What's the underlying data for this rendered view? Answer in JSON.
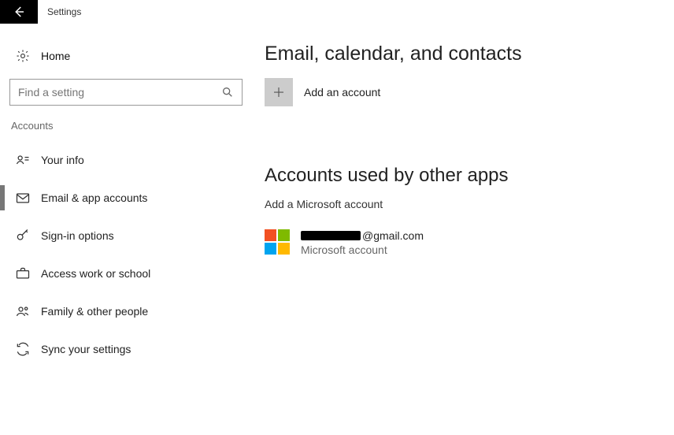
{
  "header": {
    "title": "Settings"
  },
  "sidebar": {
    "home_label": "Home",
    "search_placeholder": "Find a setting",
    "category_label": "Accounts",
    "items": [
      {
        "label": "Your info"
      },
      {
        "label": "Email & app accounts"
      },
      {
        "label": "Sign-in options"
      },
      {
        "label": "Access work or school"
      },
      {
        "label": "Family & other people"
      },
      {
        "label": "Sync your settings"
      }
    ]
  },
  "main": {
    "section1_title": "Email, calendar, and contacts",
    "add_account_label": "Add an account",
    "section2_title": "Accounts used by other apps",
    "add_ms_label": "Add a Microsoft account",
    "account": {
      "email_suffix": "@gmail.com",
      "type_label": "Microsoft account"
    }
  }
}
